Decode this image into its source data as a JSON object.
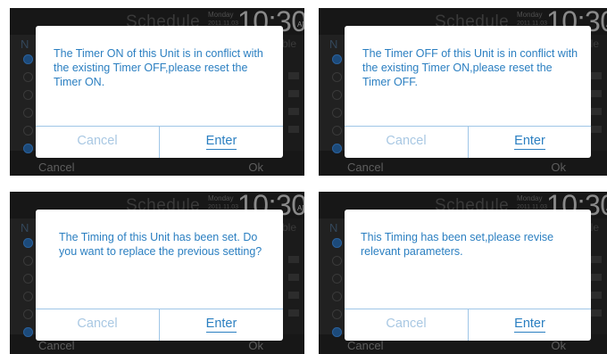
{
  "background": {
    "title": "Schedule",
    "day": "Monday",
    "date": "2011.11.03",
    "time": "10:30",
    "ampm": "AM",
    "left_fragment": "N",
    "right_fragment": "ble",
    "cancel_label": "Cancel",
    "ok_label": "Ok"
  },
  "dialogs": [
    {
      "message": "The Timer ON of this Unit is in conflict with the existing Timer OFF,please reset the Timer ON.",
      "cancel_label": "Cancel",
      "enter_label": "Enter"
    },
    {
      "message": "The Timer OFF of this Unit is in conflict with the existing Timer ON,please reset the Timer OFF.",
      "cancel_label": "Cancel",
      "enter_label": "Enter"
    },
    {
      "message": "The Timing of this Unit has been set. Do you want to replace the previous setting?",
      "cancel_label": "Cancel",
      "enter_label": "Enter"
    },
    {
      "message": "This Timing has been set,please revise relevant parameters.",
      "cancel_label": "Cancel",
      "enter_label": "Enter"
    }
  ],
  "colors": {
    "accent": "#2b7fc1",
    "disabled": "#a9c8e3",
    "panel": "#171717"
  }
}
